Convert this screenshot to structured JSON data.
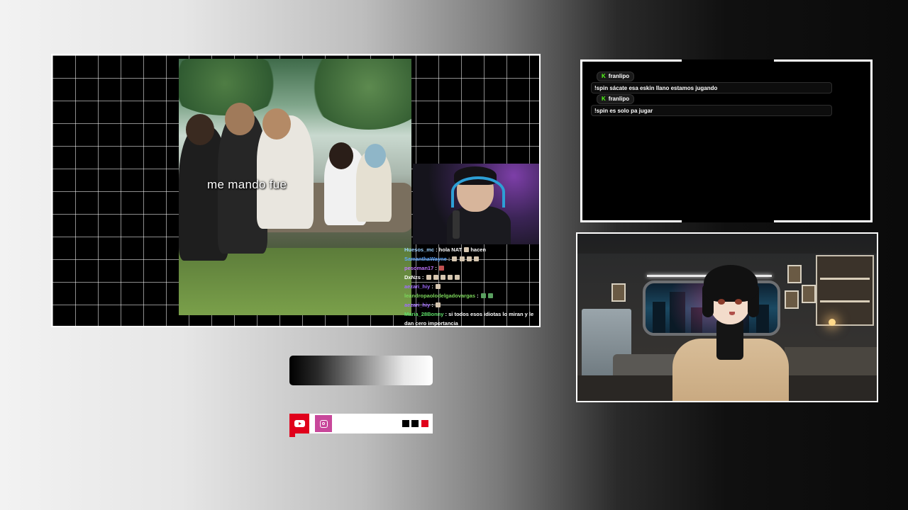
{
  "clip": {
    "caption": "me mando fue"
  },
  "stream_chat": [
    {
      "user": "Huesos_mc",
      "user_color": "#9bd2ff",
      "text": "hola NAT",
      "emote_after": "hacen"
    },
    {
      "user": "SamanthaWayne",
      "user_color": "#5fa8ff",
      "text": ""
    },
    {
      "user": "pesoman17",
      "user_color": "#c074ff",
      "text": ""
    },
    {
      "user": "DxNzs",
      "user_color": "#ffffff",
      "text": ""
    },
    {
      "user": "aezari_hiy",
      "user_color": "#a16bff",
      "text": ""
    },
    {
      "user": "leandropaolodelgadovargas",
      "user_color": "#7bd65a",
      "text": ""
    },
    {
      "user": "aezari_hiy",
      "user_color": "#a16bff",
      "text": ""
    },
    {
      "user": "Maria_28Bonny",
      "user_color": "#5fe06a",
      "text": "si todos esos idiotas lo miran y le dan cero importancia"
    }
  ],
  "chat_box": {
    "messages": [
      {
        "username": "franlipo",
        "text": "!spin sácate esa eskin llano estamos jugando"
      },
      {
        "username": "franlipo",
        "text": "!spin es solo pa jugar"
      }
    ]
  },
  "icons": {
    "youtube": "youtube-icon",
    "instagram": "instagram-icon",
    "kick": "kick-icon"
  },
  "colors": {
    "kick_green": "#53fc18",
    "youtube_red": "#e0001b",
    "instagram_pink": "#c8479a"
  }
}
